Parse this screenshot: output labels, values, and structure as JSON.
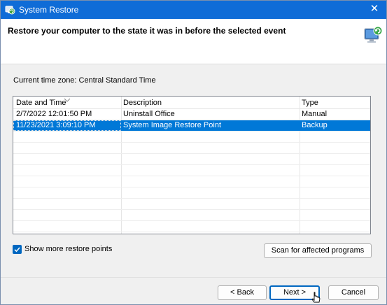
{
  "window": {
    "title": "System Restore",
    "close_glyph": "✕",
    "icon": "system-restore-icon"
  },
  "header": {
    "text": "Restore your computer to the state it was in before the selected event",
    "icon": "computer-restore-icon"
  },
  "timezone": "Current time zone: Central Standard Time",
  "list": {
    "columns": [
      "Date and Time",
      "Description",
      "Type"
    ],
    "rows": [
      {
        "date": "2/7/2022 12:01:50 PM",
        "description": "Uninstall Office",
        "type": "Manual",
        "selected": false
      },
      {
        "date": "11/23/2021 3:09:10 PM",
        "description": "System Image Restore Point",
        "type": "Backup",
        "selected": true
      }
    ]
  },
  "show_more": {
    "label": "Show more restore points",
    "checked": true
  },
  "buttons": {
    "scan": "Scan for affected programs",
    "back": "< Back",
    "next": "Next >",
    "cancel": "Cancel"
  },
  "colors": {
    "titlebar": "#0f6cd7",
    "selection": "#0078d7",
    "accent": "#0067c0"
  }
}
